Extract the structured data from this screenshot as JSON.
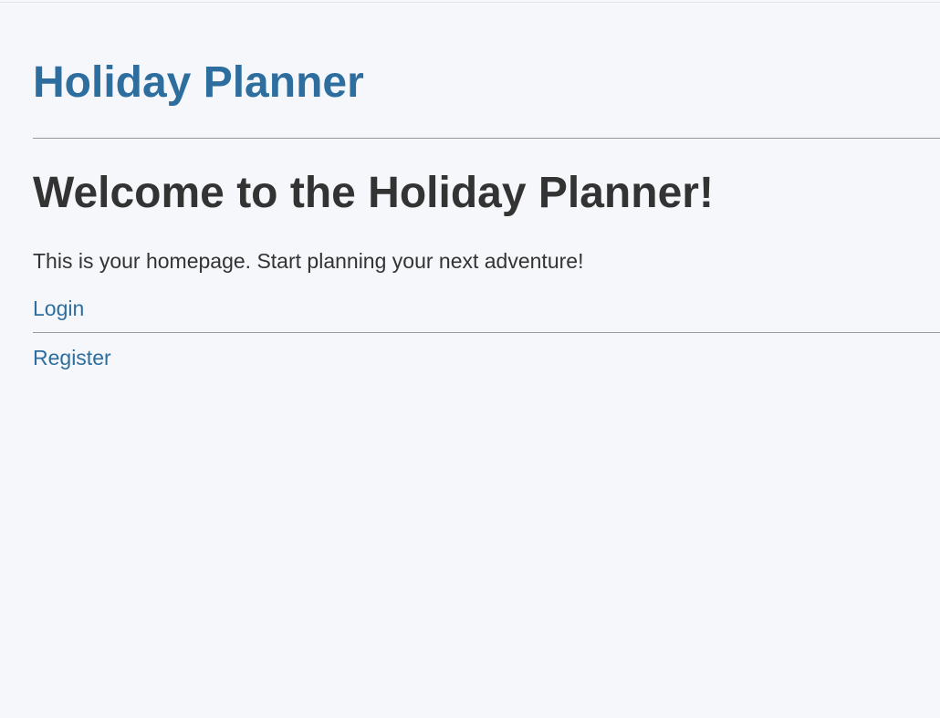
{
  "header": {
    "title": "Holiday Planner"
  },
  "main": {
    "heading": "Welcome to the Holiday Planner!",
    "intro": "This is your homepage. Start planning your next adventure!"
  },
  "nav": {
    "login_label": "Login",
    "register_label": "Register"
  },
  "colors": {
    "background": "#f5f7fa",
    "brand": "#2e6e9e",
    "text": "#333333",
    "divider": "#9a9a9a"
  }
}
